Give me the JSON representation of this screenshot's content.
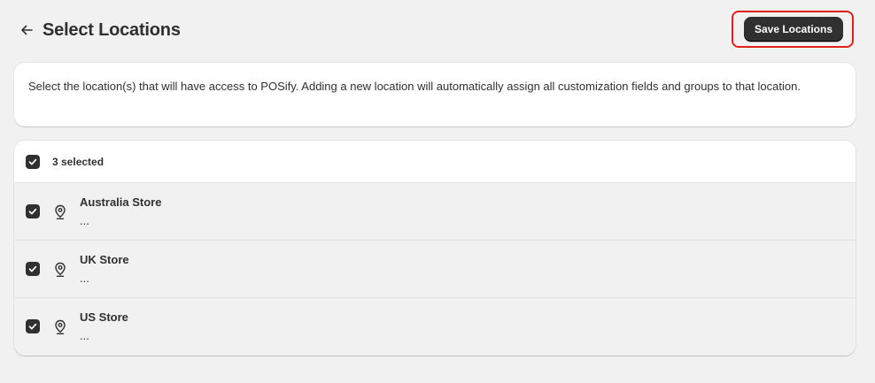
{
  "header": {
    "title": "Select Locations",
    "save_label": "Save Locations"
  },
  "description": {
    "text": "Select the location(s) that will have access to POSify. Adding a new location will automatically assign all customization fields and groups to that location."
  },
  "locations": {
    "selected_label": "3 selected",
    "items": [
      {
        "name": "Australia Store",
        "detail": "...",
        "checked": true
      },
      {
        "name": "UK Store",
        "detail": "...",
        "checked": true
      },
      {
        "name": "US Store",
        "detail": "...",
        "checked": true
      }
    ]
  },
  "colors": {
    "accent": "#303030",
    "highlight": "#e0201f",
    "background": "#f1f1f1"
  },
  "icons": {
    "back": "arrow-left-icon",
    "check": "checkmark-icon",
    "location": "location-pin-icon"
  }
}
